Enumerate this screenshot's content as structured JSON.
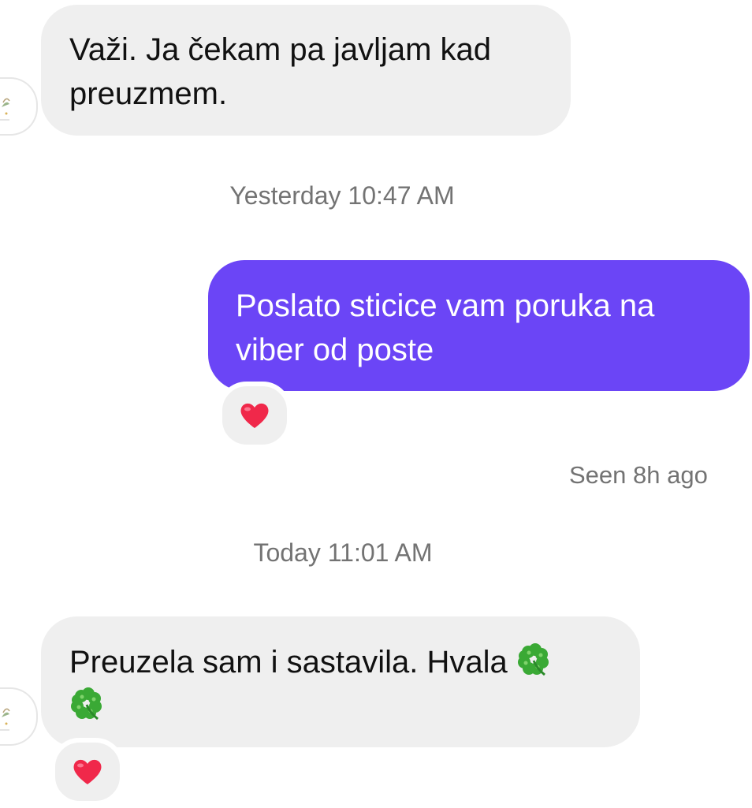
{
  "conversation": {
    "messages": [
      {
        "direction": "incoming",
        "text": "Važi. Ja čekam pa javljam kad preuzmem."
      },
      {
        "direction": "outgoing",
        "text": "Poslato sticice vam poruka na viber od poste",
        "reaction": "heart-emoji"
      },
      {
        "direction": "incoming",
        "text": "Preuzela sam i sastavila. Hvala",
        "emoji": [
          "four-leaf-clover-emoji",
          "four-leaf-clover-emoji"
        ],
        "reaction": "heart-emoji"
      }
    ],
    "timestamps": {
      "yesterday": "Yesterday 10:47 AM",
      "today": "Today 11:01 AM"
    },
    "seen_status": "Seen 8h ago"
  },
  "colors": {
    "outgoing_bubble": "#6b45f6",
    "incoming_bubble": "#efefef",
    "timestamp_text": "#737373",
    "heart": "#f0284a",
    "clover": "#3aa935"
  }
}
